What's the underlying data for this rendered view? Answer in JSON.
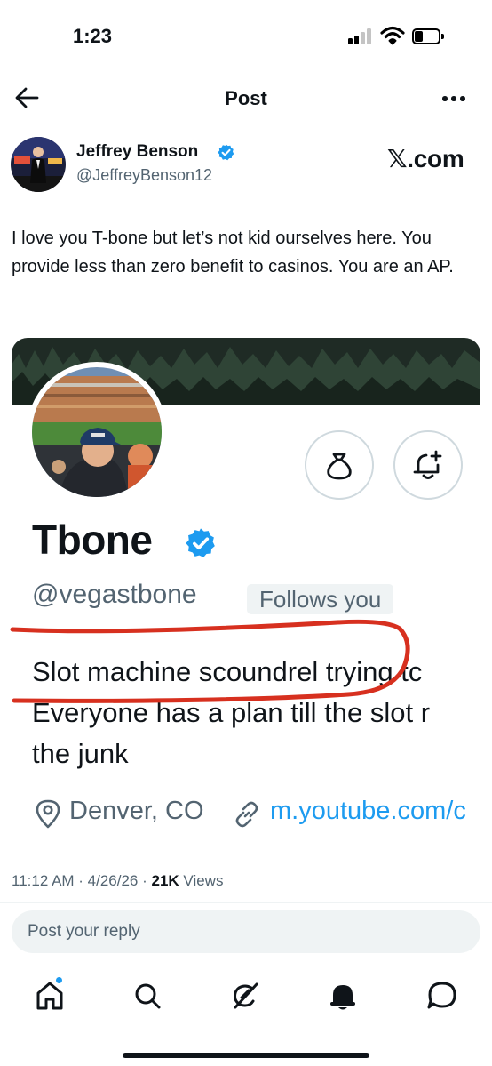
{
  "status_bar": {
    "time": "1:23",
    "battery_level_fraction": 0.2
  },
  "header": {
    "title": "Post",
    "back_icon": "arrow-left-icon",
    "more_icon": "more-dots-icon"
  },
  "author": {
    "name": "Jeffrey Benson",
    "handle": "@JeffreyBenson12",
    "verified": true,
    "badge_label": "𝕏.com"
  },
  "tweet": {
    "text": "I love you T-bone but let’s not kid ourselves here. You provide less than zero benefit to casinos. You are an AP."
  },
  "embedded_profile": {
    "name": "Tbone",
    "verified": true,
    "handle": "@vegastbone",
    "follows_badge": "Follows you",
    "bio_lines": [
      "Slot machine scoundrel trying tc",
      "Everyone has a plan till the slot r",
      "the junk"
    ],
    "location": "Denver, CO",
    "link": "m.youtube.com/c",
    "action_icons": [
      "money-bag-icon",
      "bell-plus-icon"
    ],
    "annotation_color": "#d7301f"
  },
  "meta": {
    "time_date": "11:12 AM · 4/26/26 · ",
    "views_count": "21K",
    "views_label": " Views"
  },
  "reply": {
    "placeholder": "Post your reply"
  },
  "tab_bar": {
    "icons": [
      "home-icon",
      "search-icon",
      "grok-icon",
      "notifications-icon",
      "messages-icon"
    ],
    "home_has_unread": true
  },
  "colors": {
    "accent": "#1d9bf0",
    "text": "#0f1419",
    "secondary": "#536471"
  }
}
